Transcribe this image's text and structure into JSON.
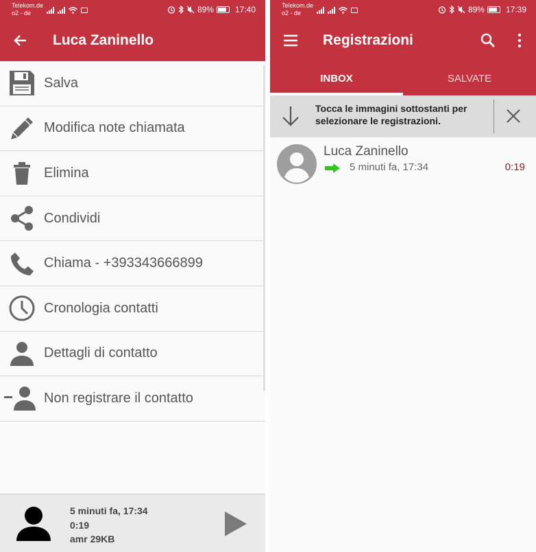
{
  "left": {
    "status": {
      "carrier1": "Telekom.de",
      "carrier2": "o2 - de",
      "battery": "89%",
      "time": "17:40"
    },
    "appbar": {
      "title": "Luca Zaninello"
    },
    "menu": [
      {
        "label": "Salva",
        "icon": "save-icon"
      },
      {
        "label": "Modifica note chiamata",
        "icon": "pencil-icon"
      },
      {
        "label": "Elimina",
        "icon": "trash-icon"
      },
      {
        "label": "Condividi",
        "icon": "share-icon"
      },
      {
        "label": "Chiama - +393343666899",
        "icon": "phone-icon"
      },
      {
        "label": "Cronologia contatti",
        "icon": "clock-icon"
      },
      {
        "label": "Dettagli di contatto",
        "icon": "person-icon"
      },
      {
        "label": "Non registrare il contatto",
        "icon": "person-remove-icon"
      }
    ],
    "player": {
      "when": "5 minuti fa, 17:34",
      "duration": "0:19",
      "format": "amr 29KB"
    }
  },
  "right": {
    "status": {
      "carrier1": "Telekom.de",
      "carrier2": "o2 - de",
      "battery": "89%",
      "time": "17:39"
    },
    "appbar": {
      "title": "Registrazioni"
    },
    "tabs": [
      {
        "label": "INBOX",
        "active": true
      },
      {
        "label": "SALVATE",
        "active": false
      }
    ],
    "hint": {
      "text": "Tocca le immagini sottostanti per selezionare le registrazioni."
    },
    "recording": {
      "name": "Luca Zaninello",
      "when": "5 minuti fa, 17:34",
      "duration": "0:19"
    }
  },
  "colors": {
    "appbar": "#c2323f",
    "arrow_green": "#2ec71f",
    "duration_red": "#8b1a1a"
  }
}
